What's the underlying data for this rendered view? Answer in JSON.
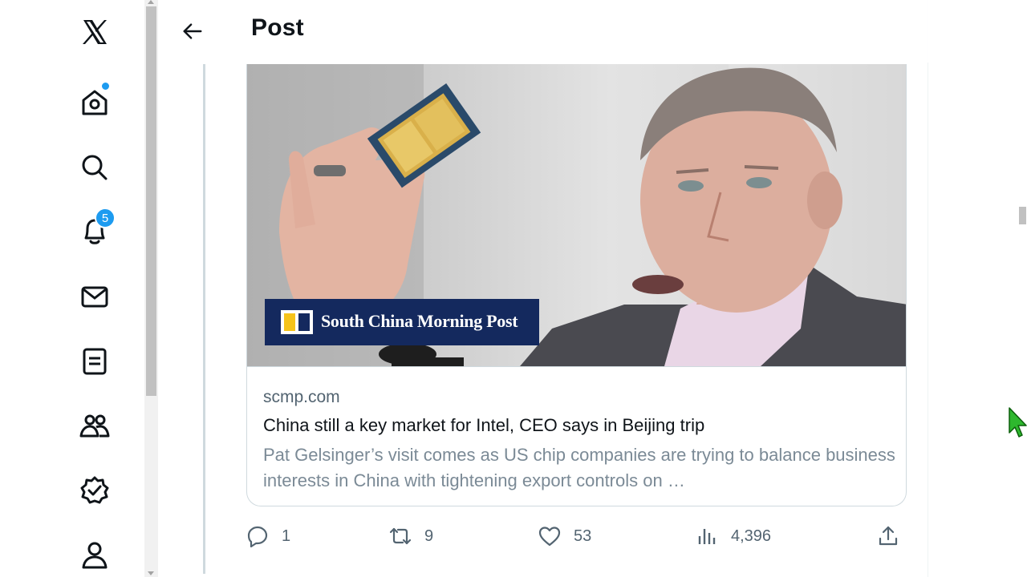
{
  "nav": {
    "items": [
      {
        "name": "x-logo-icon"
      },
      {
        "name": "home-icon"
      },
      {
        "name": "search-icon"
      },
      {
        "name": "notifications-icon",
        "badge": "5"
      },
      {
        "name": "messages-icon"
      },
      {
        "name": "lists-icon"
      },
      {
        "name": "communities-icon"
      },
      {
        "name": "verified-icon"
      },
      {
        "name": "profile-icon"
      }
    ]
  },
  "header": {
    "title": "Post"
  },
  "card": {
    "image_logo_text": "South China Morning Post",
    "domain": "scmp.com",
    "headline": "China still a key market for Intel, CEO says in Beijing trip",
    "description": "Pat Gelsinger’s visit comes as US chip companies are trying to balance business interests in China with tightening export controls on …"
  },
  "actions": {
    "replies": "1",
    "reposts": "9",
    "likes": "53",
    "views": "4,396"
  },
  "colors": {
    "accent": "#1d9bf0",
    "muted_text": "#536471",
    "scmp_navy": "#14295e",
    "scmp_yellow": "#f6c31a",
    "cursor_green": "#2eb82e"
  }
}
